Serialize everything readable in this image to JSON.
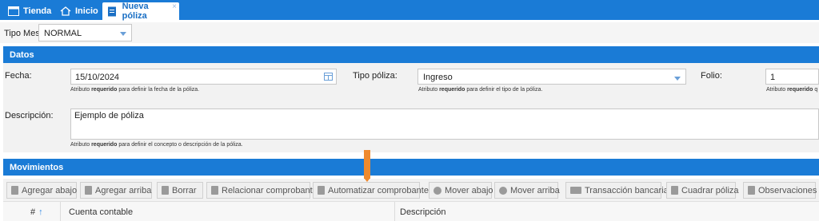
{
  "tabs": [
    {
      "label": "Tienda",
      "icon": "window-icon"
    },
    {
      "label": "Inicio",
      "icon": "home-icon"
    },
    {
      "label": "Nueva póliza",
      "icon": "document-icon",
      "active": true,
      "close": "×"
    }
  ],
  "tipo_mes": {
    "label": "Tipo Mes",
    "value": "NORMAL"
  },
  "datos": {
    "header": "Datos",
    "fecha": {
      "label": "Fecha:",
      "value": "15/10/2024",
      "hint_prefix": "Atributo",
      "hint_bold": "requerido",
      "hint_suffix": "para definir la fecha de la póliza."
    },
    "tipo_poliza": {
      "label": "Tipo póliza:",
      "value": "Ingreso",
      "hint_prefix": "Atributo",
      "hint_bold": "requerido",
      "hint_suffix": "para definir el tipo de la póliza."
    },
    "folio": {
      "label": "Folio:",
      "value": "1",
      "hint_prefix": "Atributo",
      "hint_bold": "requerido",
      "hint_suffix": "q"
    },
    "descripcion": {
      "label": "Descripción:",
      "value": "Ejemplo de póliza",
      "hint_prefix": "Atributo",
      "hint_bold": "requerido",
      "hint_suffix": "para definir el concepto o descripción de la póliza."
    }
  },
  "movimientos": {
    "header": "Movimientos",
    "toolbar": [
      {
        "label": "Agregar abajo",
        "icon": "add-below-icon"
      },
      {
        "label": "Agregar arriba",
        "icon": "add-above-icon"
      },
      {
        "label": "Borrar",
        "icon": "trash-icon"
      },
      {
        "label": "Relacionar comprobante",
        "icon": "link-document-icon"
      },
      {
        "label": "Automatizar comprobante",
        "icon": "automate-document-icon"
      },
      {
        "label": "Mover abajo",
        "icon": "arrow-down-icon"
      },
      {
        "label": "Mover arriba",
        "icon": "arrow-up-icon"
      },
      {
        "label": "Transacción bancaria",
        "icon": "bank-card-icon"
      },
      {
        "label": "Cuadrar póliza",
        "icon": "balance-icon"
      },
      {
        "label": "Observaciones",
        "icon": "notes-icon"
      }
    ],
    "columns": [
      "#",
      "Cuenta contable",
      "Descripción"
    ],
    "sort_indicator": "↑"
  },
  "colors": {
    "header_blue": "#1a7bd6",
    "marker_orange": "#ef8a2e"
  }
}
